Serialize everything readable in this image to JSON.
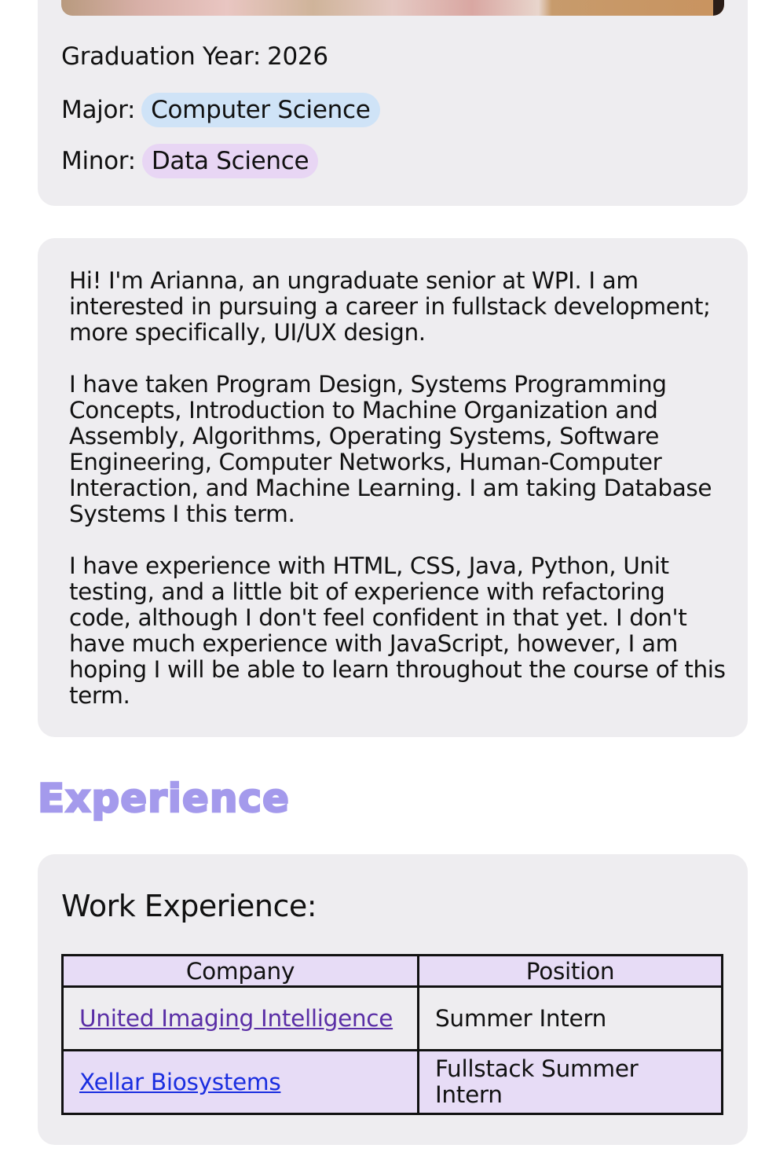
{
  "profile": {
    "graduation_label": "Graduation Year:",
    "graduation_year": "2026",
    "major_label": "Major:",
    "major": "Computer Science",
    "minor_label": "Minor:",
    "minor": "Data Science"
  },
  "bio": {
    "paragraphs": [
      "Hi! I'm Arianna, an ungraduate senior at WPI. I am interested in pursuing a career in fullstack development; more specifically, UI/UX design.",
      "I have taken Program Design, Systems Programming Concepts, Introduction to Machine Organization and Assembly, Algorithms, Operating Systems, Software Engineering, Computer Networks, Human-Computer Interaction, and Machine Learning. I am taking Database Systems I this term.",
      "I have experience with HTML, CSS, Java, Python, Unit testing, and a little bit of experience with refactoring code, although I don't feel confident in that yet. I don't have much experience with JavaScript, however, I am hoping I will be able to learn throughout the course of this term."
    ]
  },
  "experience": {
    "section_title": "Experience",
    "work_title": "Work Experience:",
    "columns": [
      "Company",
      "Position"
    ],
    "rows": [
      {
        "company": "United Imaging Intelligence",
        "position": "Summer Intern"
      },
      {
        "company": "Xellar Biosystems",
        "position": "Fullstack Summer Intern"
      }
    ]
  },
  "colors": {
    "card_bg": "#eeedf0",
    "heading_accent": "#a49aec",
    "major_pill": "#cfe3f7",
    "minor_pill": "#e8d6f4",
    "table_header_bg": "#e7dcf6",
    "visited_link": "#5a2ea6",
    "link": "#1a2ee0"
  }
}
